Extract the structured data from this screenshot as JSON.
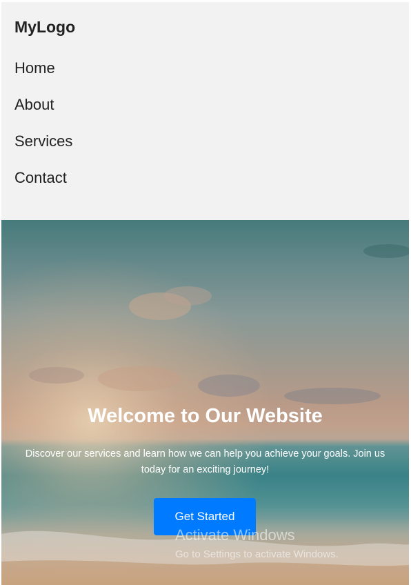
{
  "navbar": {
    "logo": "MyLogo",
    "items": [
      {
        "label": "Home"
      },
      {
        "label": "About"
      },
      {
        "label": "Services"
      },
      {
        "label": "Contact"
      }
    ],
    "background": "#f2f2f2"
  },
  "hero": {
    "title": "Welcome to Our Website",
    "text": "Discover our services and learn how we can help you achieve your goals. Join us today for an exciting journey!",
    "button_label": "Get Started",
    "button_color": "#007bff"
  },
  "watermark": {
    "title": "Activate Windows",
    "subtitle": "Go to Settings to activate Windows."
  }
}
